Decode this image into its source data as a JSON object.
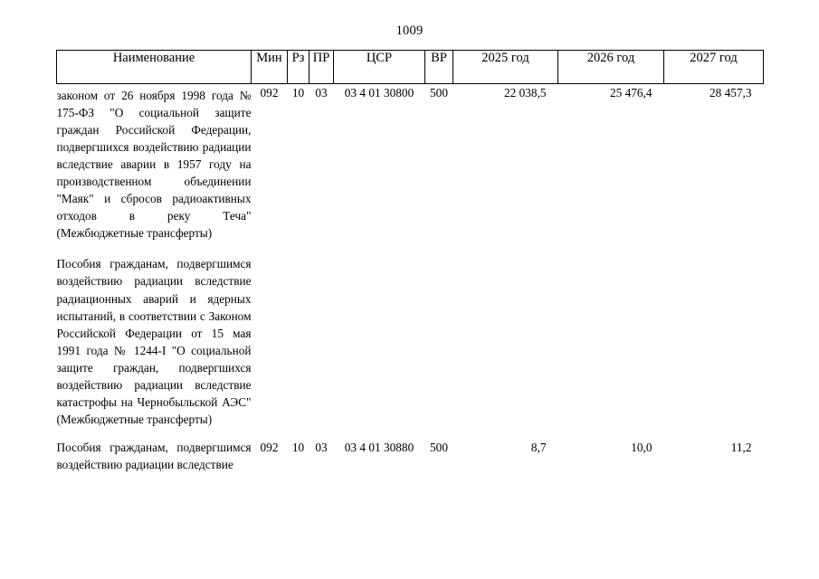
{
  "page": {
    "number": "1009"
  },
  "table": {
    "columns": [
      {
        "id": "name",
        "label": "Наименование"
      },
      {
        "id": "min",
        "label": "Мин"
      },
      {
        "id": "rz",
        "label": "Рз"
      },
      {
        "id": "pr",
        "label": "ПР"
      },
      {
        "id": "csr",
        "label": "ЦСР"
      },
      {
        "id": "vr",
        "label": "ВР"
      },
      {
        "id": "y2025",
        "label": "2025 год"
      },
      {
        "id": "y2026",
        "label": "2026 год"
      },
      {
        "id": "y2027",
        "label": "2027 год"
      }
    ],
    "rows": [
      {
        "paragraphs": [
          "законом от 26 ноября 1998 года № 175-ФЗ \"О социальной защите граждан Российской Федерации, подвергшихся воздействию радиации вследствие аварии в 1957 году на производственном объединении \"Маяк\" и сбросов радиоактивных отходов в реку Теча\" (Межбюджетные трансферты)",
          "Пособия гражданам, подвергшимся воздействию радиации вследствие радиационных аварий и ядерных испытаний, в соответствии с Законом Российской Федерации от 15 мая 1991 года № 1244-I \"О социальной защите граждан, подвергшихся воздействию радиации вследствие катастрофы на Чернобыльской АЭС\" (Межбюджетные трансферты)"
        ],
        "min": "092",
        "rz": "10",
        "pr": "03",
        "csr": "03 4 01 30800",
        "vr": "500",
        "y2025": "22 038,5",
        "y2026": "25 476,4",
        "y2027": "28 457,3"
      },
      {
        "paragraphs": [
          "Пособия гражданам, подвергшимся воздействию радиации вследствие"
        ],
        "min": "092",
        "rz": "10",
        "pr": "03",
        "csr": "03 4 01 30880",
        "vr": "500",
        "y2025": "8,7",
        "y2026": "10,0",
        "y2027": "11,2"
      }
    ]
  }
}
